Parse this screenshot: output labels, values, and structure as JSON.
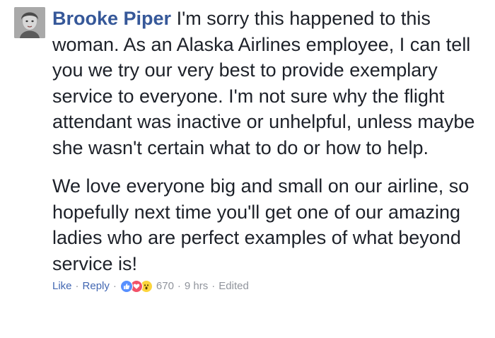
{
  "comment": {
    "author": "Brooke Piper",
    "paragraph_1": " I'm sorry this happened to this woman. As an Alaska Airlines employee, I can tell you we try our very best to provide exemplary service to everyone. I'm not sure why the flight attendant was inactive or unhelpful, unless maybe she wasn't certain what to do or how to help.",
    "paragraph_2": "We love everyone big and small on our airline, so hopefully next time you'll get one of our amazing ladies who are perfect examples of what beyond service is!",
    "actions": {
      "like_label": "Like",
      "reply_label": "Reply",
      "separator": "·"
    },
    "reactions": {
      "icons": [
        "like-icon",
        "love-icon",
        "wow-icon"
      ],
      "count": "670"
    },
    "timestamp": "9 hrs",
    "edited_label": "Edited"
  },
  "colors": {
    "author_link": "#365899",
    "action_link": "#4267b2",
    "meta_text": "#90949c",
    "body_text": "#1d2129",
    "like_blue": "#5890ff",
    "love_red": "#f25268",
    "wow_yellow": "#fcd53c"
  }
}
